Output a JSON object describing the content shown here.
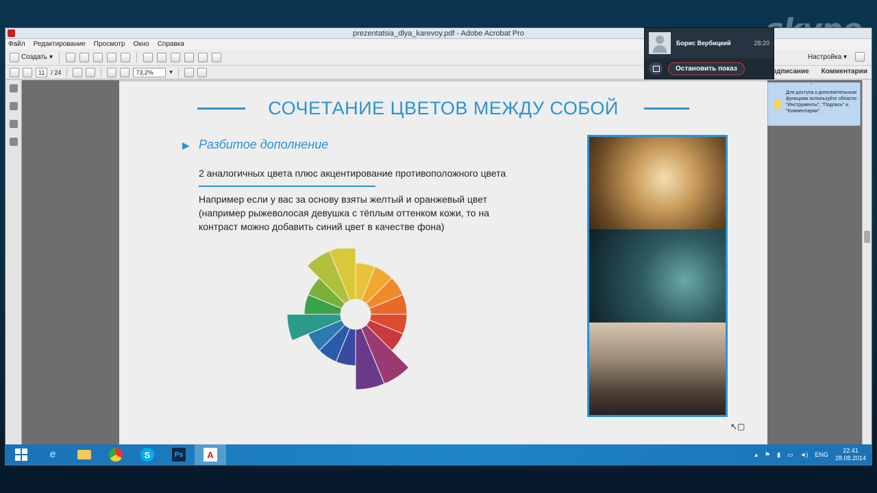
{
  "skype_logo": "skype",
  "window": {
    "title": "prezentatsia_dlya_karevoy.pdf - Adobe Acrobat Pro"
  },
  "menu": [
    "Файл",
    "Редактирование",
    "Просмотр",
    "Окно",
    "Справка"
  ],
  "toolbar": {
    "create_label": "Создать",
    "settings_label": "Настройка",
    "sign_tab": "Подписание",
    "comments_tab": "Комментарии"
  },
  "nav": {
    "page_current": "11",
    "page_total": "/ 24",
    "zoom": "73,2%"
  },
  "slide": {
    "title": "СОЧЕТАНИЕ ЦВЕТОВ МЕЖДУ СОБОЙ",
    "bullet_marker": "▶",
    "subhead": "Разбитое дополнение",
    "line1": "2 аналогичных цвета плюс акцентирование противоположного цвета",
    "paragraph": "Например если у вас за основу взяты желтый и оранжевый цвет (например рыжеволосая девушка с тёплым оттенком кожи, то на контраст можно добавить синий цвет в качестве фона)"
  },
  "call": {
    "caller_name": "Борис Вербицкий",
    "duration": "28:20",
    "stop_label": "Остановить показ"
  },
  "hint": {
    "text": "Для доступа к дополнительным функциям используйте области \"Инструменты\", \"Подпись\" и \"Комментарии\"."
  },
  "tray": {
    "lang": "ENG",
    "time": "22:41",
    "date": "28.08.2014"
  },
  "colors": {
    "accent": "#2a92d4",
    "taskbar": "#1f85c9"
  }
}
